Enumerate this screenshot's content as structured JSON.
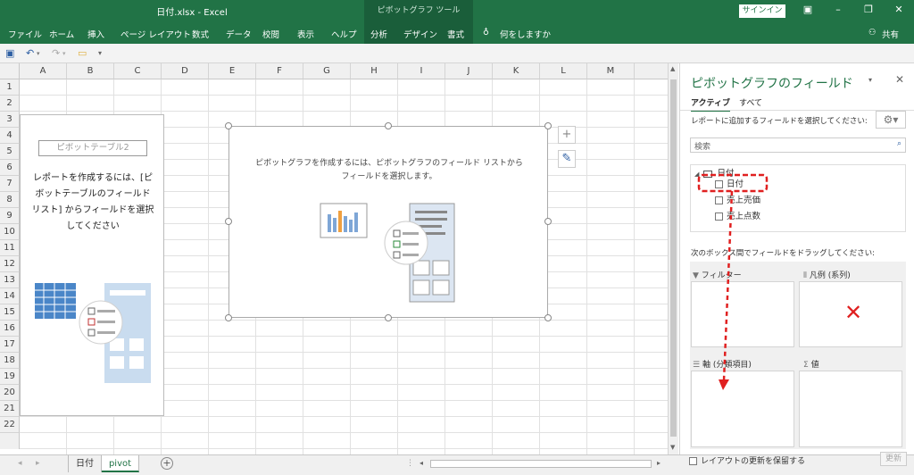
{
  "window": {
    "title": "日付.xlsx - Excel",
    "context_title": "ピボットグラフ ツール",
    "signin_label": "サインイン",
    "share_label": "共有"
  },
  "ribbon": {
    "tabs": [
      "ファイル",
      "ホーム",
      "挿入",
      "ページ レイアウト",
      "数式",
      "データ",
      "校閲",
      "表示",
      "ヘルプ",
      "分析",
      "デザイン",
      "書式"
    ],
    "tell_me": "何をしますか"
  },
  "grid": {
    "columns": [
      "A",
      "B",
      "C",
      "D",
      "E",
      "F",
      "G",
      "H",
      "I",
      "J",
      "K",
      "L",
      "M"
    ],
    "rows": [
      "1",
      "2",
      "3",
      "4",
      "5",
      "6",
      "7",
      "8",
      "9",
      "10",
      "11",
      "12",
      "13",
      "14",
      "15",
      "16",
      "17",
      "18",
      "19",
      "20",
      "21",
      "22"
    ]
  },
  "pivot_table": {
    "name": "ピボットテーブル2",
    "message_lines": [
      "レポートを作成するには、[ピ",
      "ボットテーブルのフィールド",
      "リスト] からフィールドを選択",
      "してください"
    ]
  },
  "pivot_chart": {
    "message_line1": "ピボットグラフを作成するには、ピボットグラフのフィールド リストから",
    "message_line2": "フィールドを選択します。"
  },
  "sheets": {
    "tabs": [
      "日付",
      "pivot"
    ],
    "active": "pivot"
  },
  "field_pane": {
    "title": "ピボットグラフのフィールド",
    "tab_active": "アクティブ",
    "tab_all": "すべて",
    "prompt": "レポートに追加するフィールドを選択してください:",
    "search_placeholder": "検索",
    "table_name": "日付",
    "fields": [
      "日付",
      "売上売価",
      "売上点数"
    ],
    "drag_prompt": "次のボックス間でフィールドをドラッグしてください:",
    "area_filter": "フィルター",
    "area_legend": "凡例 (系列)",
    "area_axis": "軸 (分類項目)",
    "area_values": "値",
    "defer_label": "レイアウトの更新を保留する",
    "update_label": "更新"
  },
  "colors": {
    "excel_green": "#217346",
    "annotation_red": "#e02020"
  }
}
